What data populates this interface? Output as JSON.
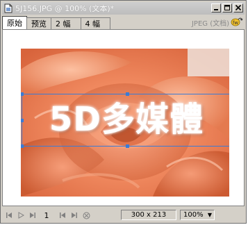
{
  "window": {
    "title": "5J156.JPG @ 100% (文本)*"
  },
  "tabs": [
    {
      "label": "原始",
      "active": true
    },
    {
      "label": "预览",
      "active": false
    },
    {
      "label": "2 幅",
      "active": false
    },
    {
      "label": "4 幅",
      "active": false
    }
  ],
  "tabbar": {
    "format_label": "JPEG (文档)"
  },
  "canvas": {
    "overlay_text": "5D多媒體"
  },
  "statusbar": {
    "page_number": "1",
    "dimensions": "300 x 213",
    "zoom": "100%"
  },
  "colors": {
    "selection": "#3a7bd5",
    "window_bg": "#d4d0c8"
  }
}
